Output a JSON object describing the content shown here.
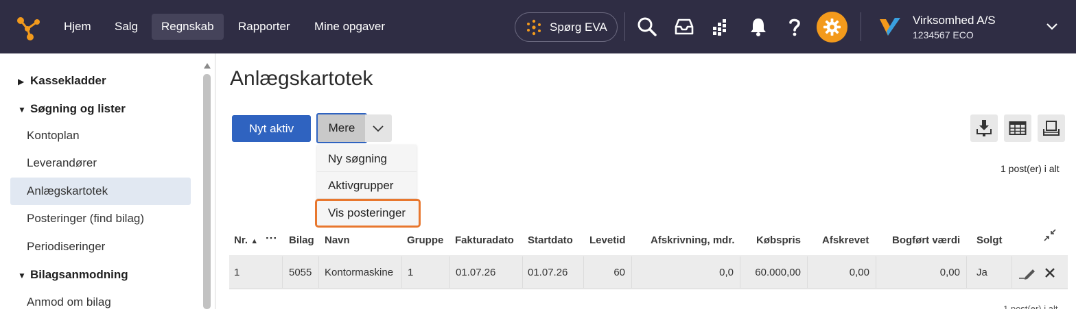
{
  "nav": {
    "items": [
      "Hjem",
      "Salg",
      "Regnskab",
      "Rapporter",
      "Mine opgaver"
    ],
    "active": "Regnskab",
    "ask_eva": "Spørg EVA",
    "company_name": "Virksomhed A/S",
    "company_id": "1234567 ECO",
    "icons": [
      "search-icon",
      "inbox-icon",
      "apps-icon",
      "bell-icon",
      "help-icon",
      "gear-icon"
    ],
    "gear_color": "#f39a1c",
    "bar_color": "#2f2d44"
  },
  "sidebar": {
    "groups": [
      {
        "label": "Kassekladder",
        "expanded": false
      },
      {
        "label": "Søgning og lister",
        "expanded": true
      },
      {
        "label": "Bilagsanmodning",
        "expanded": true
      }
    ],
    "items": [
      "Kontoplan",
      "Leverandører",
      "Anlægskartotek",
      "Posteringer (find bilag)",
      "Periodiseringer",
      "Anmod om bilag"
    ],
    "active_item": "Anlægskartotek"
  },
  "main": {
    "title": "Anlægskartotek",
    "new_button": "Nyt aktiv",
    "more_button": "Mere",
    "dropdown": [
      "Ny søgning",
      "Aktivgrupper",
      "Vis posteringer"
    ],
    "dropdown_highlight": "Vis posteringer",
    "post_count": "1 post(er) i alt",
    "accent": "#2f63c0",
    "highlight_color": "#e8772e"
  },
  "table": {
    "headers": [
      "Nr.",
      "Bilag",
      "Navn",
      "Gruppe",
      "Fakturadato",
      "Startdato",
      "Levetid",
      "Afskrivning, mdr.",
      "Købspris",
      "Afskrevet",
      "Bogført værdi",
      "Solgt"
    ],
    "sort_column": "Nr.",
    "rows": [
      [
        "1",
        "5055",
        "Kontormaskine",
        "1",
        "01.07.26",
        "01.07.26",
        "60",
        "0,0",
        "60.000,00",
        "0,00",
        "0,00",
        "Ja"
      ]
    ]
  },
  "footer_fragment": "1 post(er) i alt"
}
